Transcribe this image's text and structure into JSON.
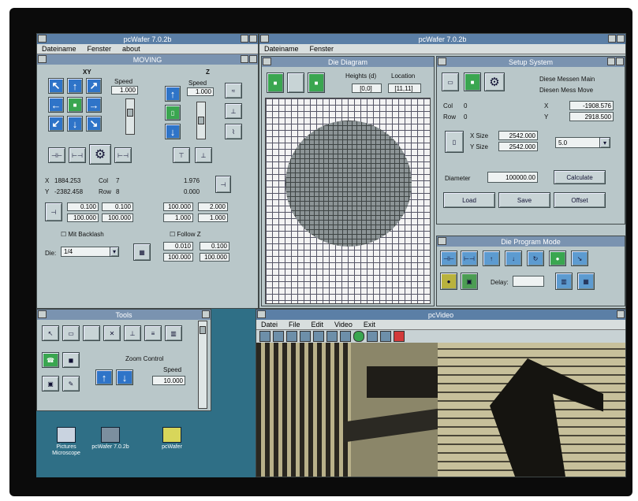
{
  "win_left": {
    "title": "pcWafer 7.0.2b",
    "menu": [
      "Dateiname",
      "Fenster",
      "about"
    ],
    "section": "MOVING",
    "xy_label": "XY",
    "z_label": "Z",
    "speed_label": "Speed",
    "speed_xy": "1.000",
    "speed_z": "1.000",
    "pos": [
      {
        "axis": "X",
        "value": "1884.253",
        "sub": "Col",
        "val2": "7"
      },
      {
        "axis": "Y",
        "value": "-2382.458",
        "sub": "Row",
        "val2": "8"
      }
    ],
    "z_pos": "1.976",
    "z_fine": "0.000",
    "rel_vals": [
      "0.100",
      "0.100",
      "100.000",
      "100.000"
    ],
    "z_vals": [
      "100.000",
      "2.000",
      "1.000",
      "1.000"
    ],
    "checkbox_backlash": "Mit Backlash",
    "checkbox_follow": "Follow Z",
    "die_label": "Die:",
    "die_value": "1/4",
    "step_fields": [
      "0.010",
      "0.100",
      "100.000",
      "100.000"
    ]
  },
  "win_tools": {
    "title": "Tools",
    "zoom_label": "Zoom Control",
    "speed_label": "Speed",
    "speed_value": "10.000"
  },
  "desktop_icons": [
    "Pictures Microscope",
    "pcWafer 7.0.2b",
    "pcWafer"
  ],
  "win_right": {
    "title": "pcWafer 7.0.2b",
    "menu": [
      "Dateiname",
      "Fenster"
    ]
  },
  "die_diagram": {
    "title": "Die Diagram",
    "labels": [
      "Heights (d)",
      "Location"
    ],
    "values": [
      "[0,0]",
      "[11,11]"
    ]
  },
  "setup": {
    "title": "Setup System",
    "opt1": "Diese Messen Main",
    "opt2": "Diesen Mess Move",
    "col_label": "Col",
    "col_value": "0",
    "row_label": "Row",
    "row_value": "0",
    "x_label": "X",
    "x_value": "-1908.576",
    "y_label": "Y",
    "y_value": "2918.500",
    "xsize_label": "X Size",
    "xsize_value": "2542.000",
    "ysize_label": "Y Size",
    "ysize_value": "2542.000",
    "drop_value": "5.0",
    "diameter_label": "Diameter",
    "diameter_value": "100000.00",
    "calc_button": "Calculate",
    "btn1": "Load",
    "btn2": "Save",
    "btn3": "Offset"
  },
  "die_program": {
    "title": "Die Program Mode",
    "delay_label": "Delay:",
    "delay_value": ""
  },
  "video_win": {
    "title": "pcVideo",
    "menu": [
      "Datei",
      "File",
      "Edit",
      "Video",
      "Exit"
    ]
  }
}
